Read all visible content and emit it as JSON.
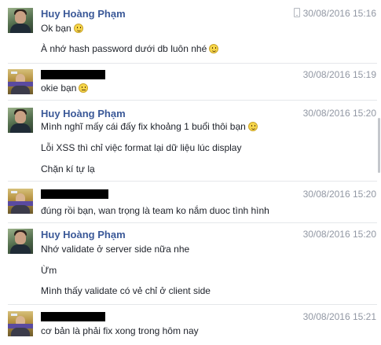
{
  "messages": [
    {
      "sender": "Huy Hoàng Phạm",
      "timestamp": "30/08/2016 15:16",
      "via_phone": true,
      "lines": [
        "Ok bạn",
        "À nhớ hash password dưới db luôn nhé"
      ]
    },
    {
      "sender_redacted": true,
      "timestamp": "30/08/2016 15:19",
      "lines": [
        "okie bạn"
      ]
    },
    {
      "sender": "Huy Hoàng Phạm",
      "timestamp": "30/08/2016 15:20",
      "lines": [
        "Mình nghĩ mấy cái đấy fix khoảng 1 buổi thôi bạn",
        "Lỗi XSS thì chỉ việc format lại dữ liệu lúc display",
        "Chặn kí tự lạ"
      ]
    },
    {
      "sender_redacted": true,
      "timestamp": "30/08/2016 15:20",
      "lines": [
        "đúng rồi bạn, wan trọng là team ko nắm duoc tình hình"
      ]
    },
    {
      "sender": "Huy Hoàng Phạm",
      "timestamp": "30/08/2016 15:20",
      "lines": [
        "Nhớ validate ở server side nữa nhe",
        "Ừm",
        "Mình thấy validate có vẻ chỉ ở client side"
      ]
    },
    {
      "sender_redacted": true,
      "timestamp": "30/08/2016 15:21",
      "lines": [
        "cơ bản là phải fix xong trong hôm nay"
      ]
    }
  ],
  "icons": {
    "smile": "smile-emoji-icon",
    "meh": "meh-emoji-icon",
    "phone": "mobile-phone-icon"
  },
  "colors": {
    "sender_name": "#3b5998",
    "timestamp": "#9197a3",
    "message_text": "#1d2129"
  }
}
